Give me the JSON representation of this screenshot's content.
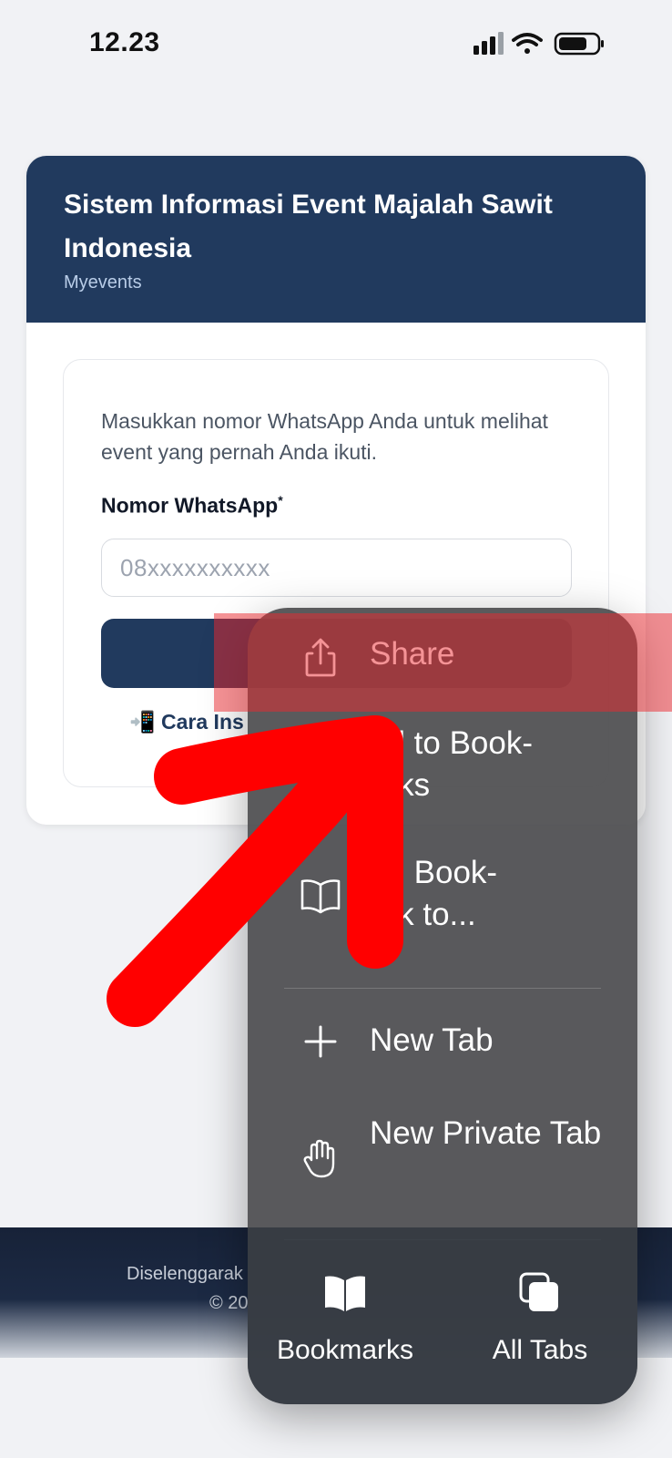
{
  "status_bar": {
    "time": "12.23",
    "icons": [
      "signal-icon",
      "wifi-icon",
      "battery-icon"
    ]
  },
  "card": {
    "title": "Sistem Informasi Event Majalah Sawit Indonesia",
    "subtitle": "Myevents",
    "intro": "Masukkan nomor WhatsApp Anda untuk melihat event yang pernah Anda ikuti.",
    "field_label": "Nomor WhatsApp",
    "field_required_mark": "*",
    "input_placeholder": "08xxxxxxxxxx",
    "input_value": "",
    "help_link": "📲 Cara Ins"
  },
  "footer": {
    "line1": "Diselenggarak",
    "line2": "© 20"
  },
  "menu": {
    "items": [
      {
        "label": "Share",
        "icon": "share-icon"
      },
      {
        "label": "dd to Book-\narks",
        "icon": "bookmark-add-icon"
      },
      {
        "label": "dd Book-\nark to...",
        "icon": "book-icon"
      },
      {
        "label": "New Tab",
        "icon": "plus-icon"
      },
      {
        "label": "New Private Tab",
        "icon": "hand-icon"
      }
    ],
    "bottom": [
      {
        "label": "Bookmarks",
        "icon": "bookmarks-book-icon"
      },
      {
        "label": "All Tabs",
        "icon": "tabs-icon"
      }
    ]
  },
  "annotation": {
    "highlight_color": "#eb282d",
    "arrow_color": "#ff0000"
  }
}
